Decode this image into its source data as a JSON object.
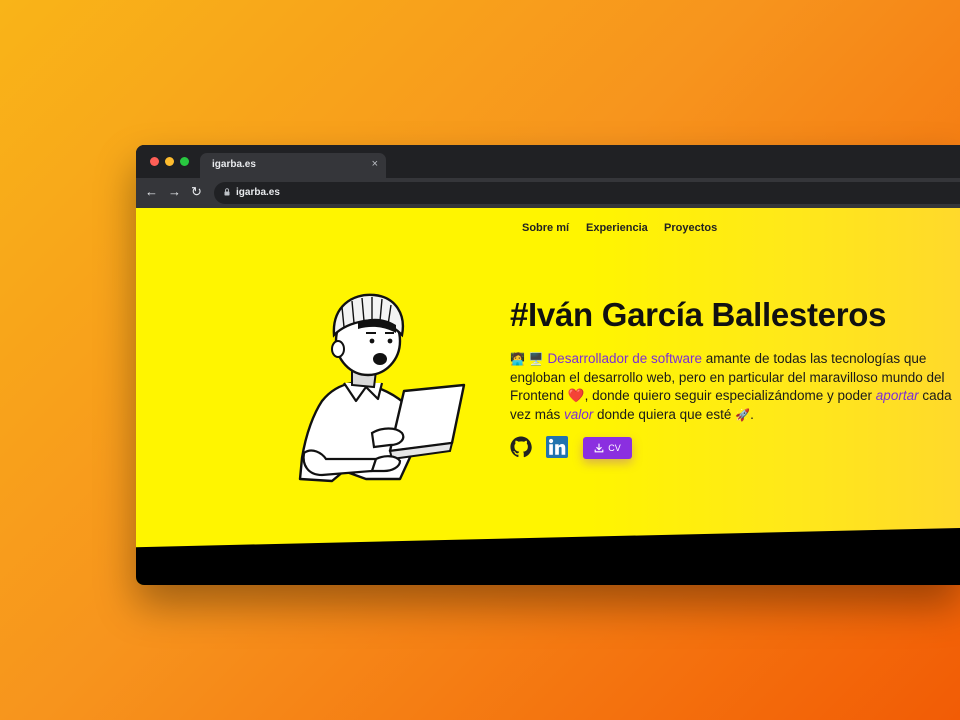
{
  "browser": {
    "tab_title": "igarba.es",
    "tab_close": "×",
    "url": "igarba.es",
    "nav": {
      "back": "←",
      "forward": "→",
      "reload": "↻"
    }
  },
  "site": {
    "nav": [
      "Sobre mí",
      "Experiencia",
      "Proyectos"
    ],
    "title": "#Iván García Ballesteros",
    "description": {
      "emoji_1": "🧑‍💻",
      "emoji_2": "🖥️",
      "role": "Desarrollador de software",
      "text_1": " amante de todas las tecnologías que engloban el desarrollo web, pero en particular del maravilloso mundo del Frontend ",
      "heart": "❤️",
      "text_2": ", donde quiero seguir especializándome y poder ",
      "aportar": "aportar",
      "text_3": " cada vez más ",
      "valor": "valor",
      "text_4": " donde quiera que esté ",
      "rocket": "🚀",
      "text_5": "."
    },
    "social": {
      "github_icon": "github-icon",
      "linkedin_icon": "linkedin-icon",
      "cv_label": "CV"
    }
  },
  "colors": {
    "accent": "#8b2fe0",
    "hero_bg": "#fff500",
    "page_bg_start": "#f9b418",
    "page_bg_end": "#f25c05"
  }
}
